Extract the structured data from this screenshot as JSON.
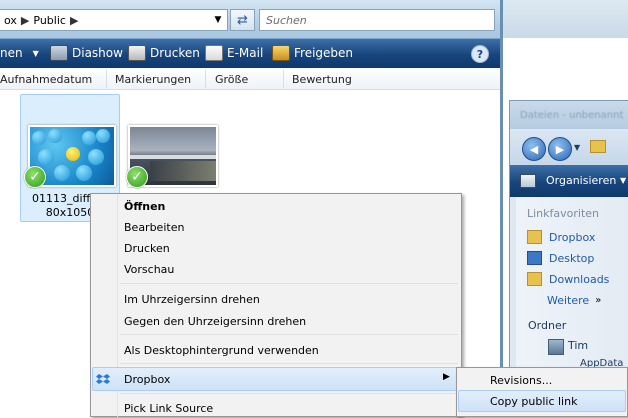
{
  "address": {
    "crumb_partial": "ox",
    "crumb": "Public"
  },
  "search": {
    "placeholder": "Suchen"
  },
  "toolbar": {
    "items": [
      {
        "label": "nen",
        "icon": "chevron-down-icon"
      },
      {
        "label": "Diashow",
        "icon": "slideshow-icon"
      },
      {
        "label": "Drucken",
        "icon": "printer-icon"
      },
      {
        "label": "E-Mail",
        "icon": "email-icon"
      },
      {
        "label": "Freigeben",
        "icon": "share-icon"
      }
    ],
    "help": "?"
  },
  "columns": [
    "Aufnahmedatum",
    "Markierungen",
    "Größe",
    "Bewertung"
  ],
  "files": [
    {
      "name": "01113_differe",
      "dims": "80x1050"
    },
    {
      "name": "",
      "dims": ""
    }
  ],
  "context_menu": {
    "items": [
      {
        "label": "Öffnen",
        "bold": true
      },
      {
        "label": "Bearbeiten"
      },
      {
        "label": "Drucken"
      },
      {
        "label": "Vorschau"
      },
      {
        "label": "Im Uhrzeigersinn drehen"
      },
      {
        "label": "Gegen den Uhrzeigersinn drehen"
      },
      {
        "label": "Als Desktophintergrund verwenden"
      },
      {
        "label": "Dropbox",
        "icon": "dropbox-icon",
        "has_submenu": true
      },
      {
        "label": "Pick Link Source"
      }
    ]
  },
  "submenu": {
    "items": [
      "Revisions...",
      "Copy public link"
    ]
  },
  "window2": {
    "title": "Dateien - unbenannt",
    "toolbar_label": "Organisieren",
    "favorites_heading": "Linkfavoriten",
    "favorites": [
      "Dropbox",
      "Desktop",
      "Downloads"
    ],
    "more_label": "Weitere",
    "folders_heading": "Ordner",
    "user": "Tim",
    "subfolder": "AppData"
  },
  "colors": {
    "toolbar": "#17447b",
    "highlight": "#cfe2f7",
    "link": "#1e5aa8"
  }
}
